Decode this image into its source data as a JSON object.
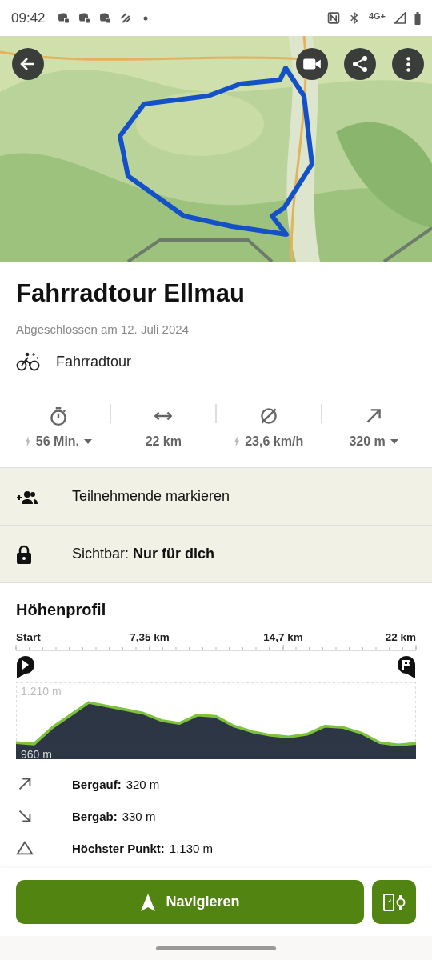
{
  "status_bar": {
    "time": "09:42",
    "network": "4G+"
  },
  "title": "Fahrradtour Ellmau",
  "date": "Abgeschlossen am 12. Juli 2024",
  "activity": "Fahrradtour",
  "stats": [
    {
      "kind": "duration",
      "value": "56 Min.",
      "bolt": true,
      "dropdown": true
    },
    {
      "kind": "distance",
      "value": "22 km",
      "bolt": false,
      "dropdown": false
    },
    {
      "kind": "speed",
      "value": "23,6 km/h",
      "bolt": true,
      "dropdown": false
    },
    {
      "kind": "ascent",
      "value": "320 m",
      "bolt": false,
      "dropdown": true
    }
  ],
  "actions": [
    {
      "kind": "participants",
      "text": "Teilnehmende markieren"
    },
    {
      "kind": "visibility",
      "text": "Sichtbar: **Nur für dich**"
    }
  ],
  "elevation": {
    "heading": "Höhenprofil",
    "chart_data": {
      "type": "area",
      "x": [
        0,
        1,
        2,
        3,
        4,
        5,
        6,
        7,
        8,
        9,
        10,
        11,
        12,
        13,
        14,
        15,
        16,
        17,
        18,
        19,
        20,
        21,
        22
      ],
      "series": [
        {
          "color": "#2d3644",
          "values": [
            973,
            968,
            1033,
            1082,
            1131,
            1117,
            1103,
            1089,
            1060,
            1049,
            1082,
            1076,
            1038,
            1016,
            1002,
            995,
            1006,
            1038,
            1033,
            1011,
            973,
            964,
            970
          ]
        }
      ],
      "xlim": [
        0,
        22
      ],
      "ylim": [
        908,
        1210
      ],
      "xticks": [
        {
          "value": 0,
          "label": "Start"
        },
        {
          "value": 7.35,
          "label": "7,35 km"
        },
        {
          "value": 14.7,
          "label": "14,7 km"
        },
        {
          "value": 22,
          "label": "22 km"
        }
      ],
      "yticks": [
        {
          "value": 1210,
          "label": "1.210 m"
        },
        {
          "value": 960,
          "label": "960 m"
        }
      ]
    },
    "facts": [
      {
        "kind": "up",
        "label": "Bergauf:",
        "value": "320 m"
      },
      {
        "kind": "down",
        "label": "Bergab:",
        "value": "330 m"
      },
      {
        "kind": "peak",
        "label": "Höchster Punkt:",
        "value": "1.130 m"
      }
    ]
  },
  "navigate_button": "Navigieren"
}
